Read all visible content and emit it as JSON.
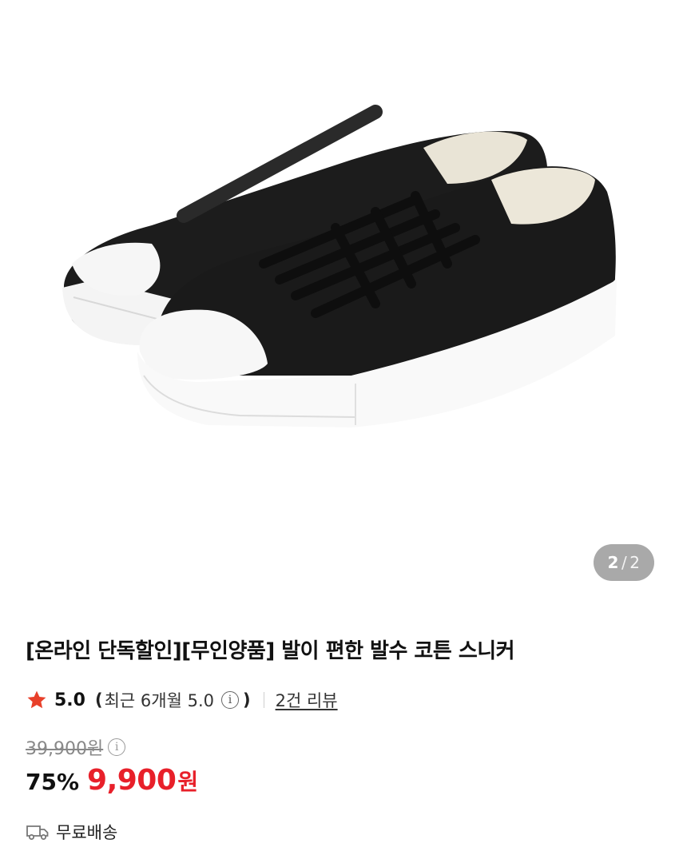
{
  "gallery": {
    "current": "2",
    "separator": "/",
    "total": "2"
  },
  "product": {
    "title": "[온라인 단독할인][무인양품] 발이 편한 발수 코튼 스니커"
  },
  "rating": {
    "score": "5.0",
    "open_paren": "(",
    "recent_label": "최근 6개월 5.0",
    "close_paren": ")",
    "review_link": "2건 리뷰"
  },
  "price": {
    "original": "39,900원",
    "discount": "75%",
    "sale": "9,900",
    "unit": "원"
  },
  "shipping": {
    "label": "무료배송"
  },
  "colors": {
    "sale_red": "#e8202a",
    "star_red": "#e8402a",
    "indicator_bg": "#a9a9a9"
  },
  "icons": {
    "star": "star-icon",
    "info": "info-icon",
    "truck": "truck-icon"
  }
}
